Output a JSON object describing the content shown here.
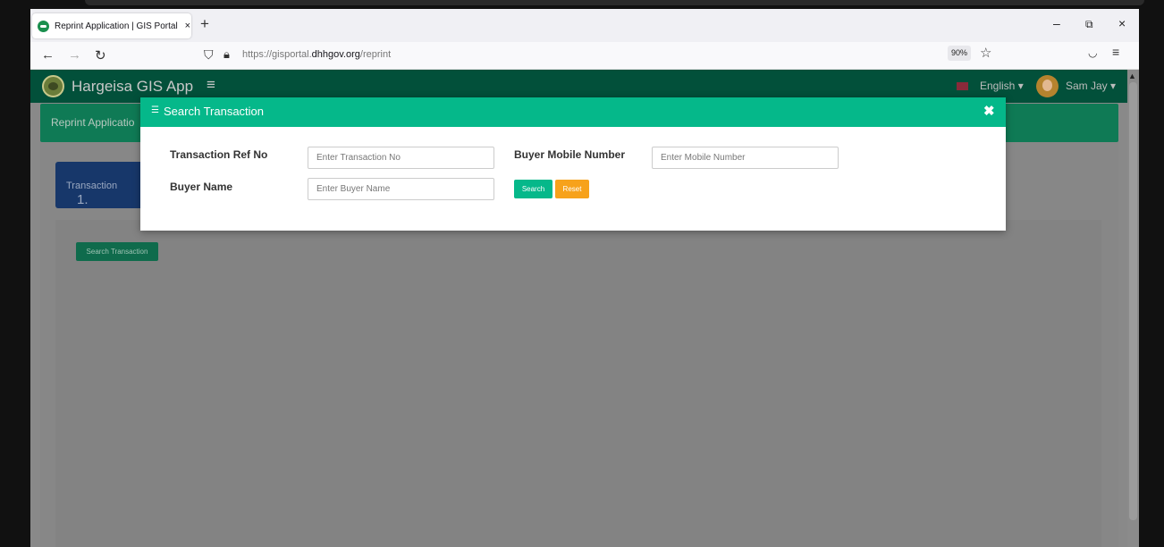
{
  "browser": {
    "tab_title": "Reprint Application | GIS Portal",
    "tab_close": "×",
    "new_tab": "+",
    "url_prefix": "https://gisportal.",
    "url_domain": "dhhgov.org",
    "url_path": "/reprint",
    "zoom": "90%",
    "window_minimize": "–",
    "window_restore": "⧉",
    "window_close": "×"
  },
  "app": {
    "name": "Hargeisa GIS App",
    "language": "English",
    "user": "Sam Jay",
    "section_title": "Reprint Applicatio",
    "step_number": "1.",
    "step_label": "Transaction",
    "search_transaction_button": "Search Transaction"
  },
  "modal": {
    "title": "Search Transaction",
    "close": "✖",
    "fields": {
      "transaction_ref_label": "Transaction Ref No",
      "transaction_ref_placeholder": "Enter Transaction No",
      "buyer_mobile_label": "Buyer Mobile Number",
      "buyer_mobile_placeholder": "Enter Mobile Number",
      "buyer_name_label": "Buyer Name",
      "buyer_name_placeholder": "Enter Buyer Name"
    },
    "search_button": "Search",
    "reset_button": "Reset"
  },
  "colors": {
    "app_bar": "#02503a",
    "modal_header": "#05b88a",
    "search_button": "#05b88a",
    "reset_button": "#f7a21b",
    "step_box": "#17376a"
  }
}
